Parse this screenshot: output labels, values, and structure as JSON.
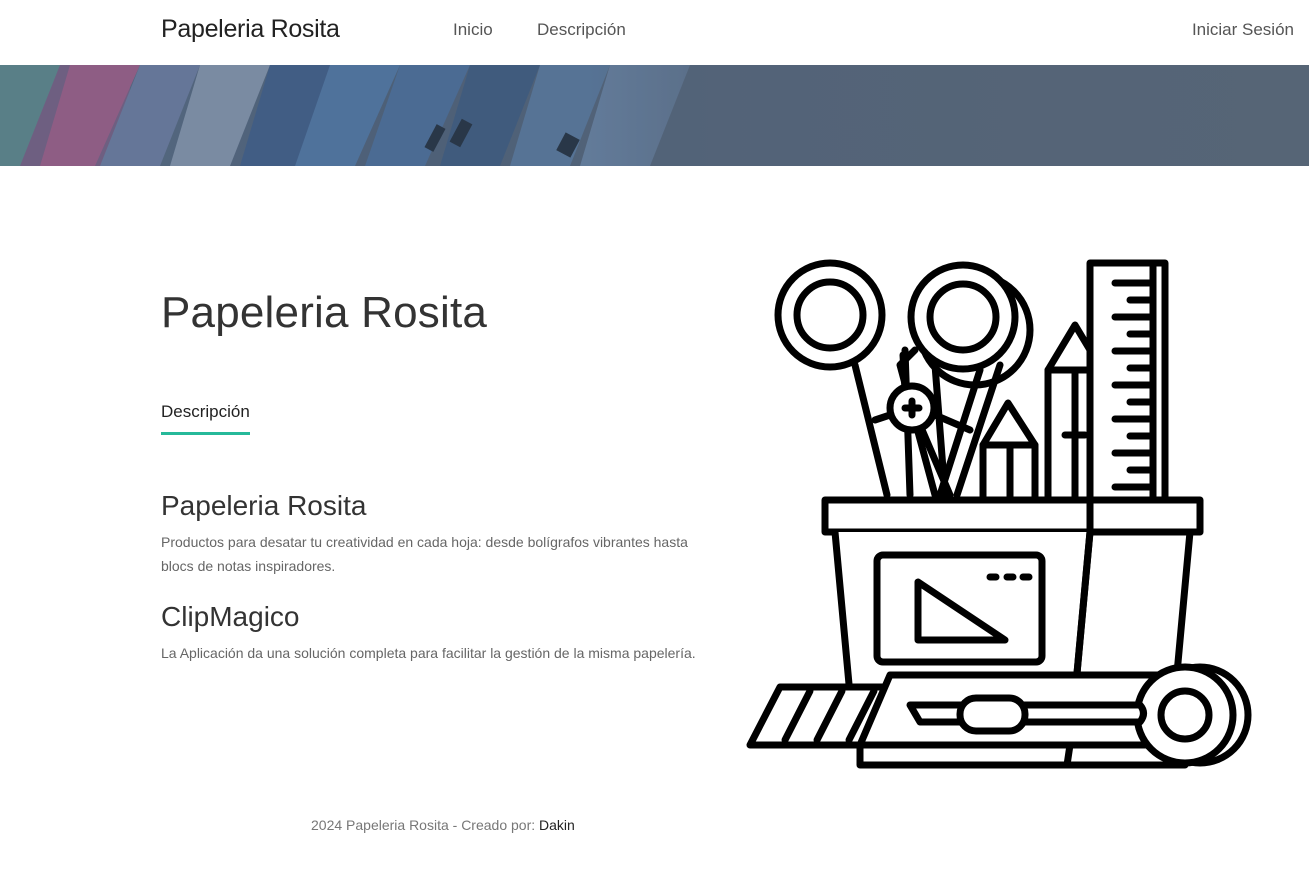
{
  "navbar": {
    "brand": "Papeleria Rosita",
    "links": [
      "Inicio",
      "Descripción"
    ],
    "login": "Iniciar Sesión"
  },
  "main": {
    "title": "Papeleria Rosita",
    "tab": "Descripción",
    "items": [
      {
        "title": "Papeleria Rosita",
        "description": "Productos para desatar tu creatividad en cada hoja: desde bolígrafos vibrantes hasta blocs de notas inspiradores."
      },
      {
        "title": "ClipMagico",
        "description": "La Aplicación da una solución completa para facilitar la gestión de la misma papelería."
      }
    ]
  },
  "footer": {
    "text": "2024 Papeleria Rosita - Creado por:",
    "author": "Dakin"
  },
  "colors": {
    "accent": "#26b99a",
    "hero": "#56657a"
  }
}
